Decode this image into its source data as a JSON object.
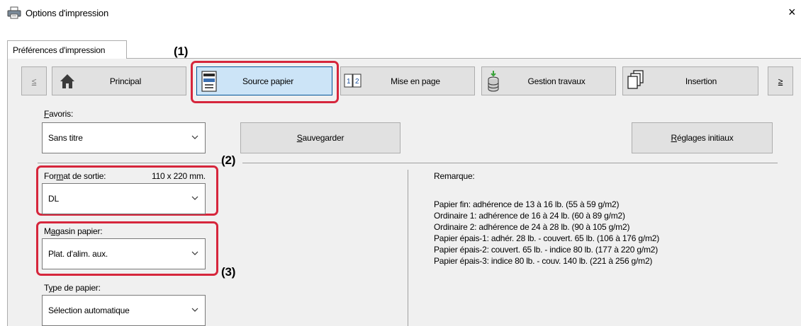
{
  "window": {
    "title": "Options d'impression",
    "close_glyph": "×"
  },
  "tab": {
    "label": "Préférences d'impression"
  },
  "nav": {
    "prev_glyph": "≤",
    "next_glyph": "≥",
    "buttons": [
      {
        "label": "Principal",
        "icon": "home-icon"
      },
      {
        "label": "Source papier",
        "icon": "paper-tray-icon",
        "selected": true
      },
      {
        "label": "Mise en page",
        "icon": "layout-icon"
      },
      {
        "label": "Gestion travaux",
        "icon": "job-storage-icon"
      },
      {
        "label": "Insertion",
        "icon": "pages-insert-icon"
      }
    ]
  },
  "favorites": {
    "label_first": "F",
    "label_rest": "avoris:",
    "value": "Sans titre",
    "save_first": "S",
    "save_rest": "auvegarder",
    "reset_first": "R",
    "reset_rest": "églages initiaux"
  },
  "output_size": {
    "label_pre": "For",
    "label_u": "m",
    "label_post": "at de sortie:",
    "dimensions": "110 x 220 mm.",
    "value": "DL"
  },
  "paper_tray": {
    "label_pre": "M",
    "label_u": "a",
    "label_post": "gasin papier:",
    "value": "Plat. d'alim. aux."
  },
  "paper_type": {
    "label_pre": "T",
    "label_u": "y",
    "label_post": "pe de papier:",
    "value": "Sélection automatique"
  },
  "remark": {
    "title": "Remarque:",
    "lines": [
      "Papier fin: adhérence de 13 à 16 lb. (55 à 59 g/m2)",
      "Ordinaire 1: adhérence de 16 à 24 lb. (60 à 89 g/m2)",
      "Ordinaire 2: adhérence de 24 à 28 lb. (90 à 105 g/m2)",
      "Papier épais-1: adhér. 28 lb. - couvert. 65 lb. (106 à 176 g/m2)",
      "Papier épais-2: couvert. 65 lb. - indice 80 lb. (177 à 220 g/m2)",
      "Papier épais-3: indice 80 lb. - couv. 140 lb. (221 à 256 g/m2)"
    ]
  },
  "callouts": {
    "c1": "(1)",
    "c2": "(2)",
    "c3": "(3)"
  },
  "colors": {
    "callout": "#d6263c",
    "selected_bg": "#cce4f7",
    "panel_bg": "#f0f0f0"
  }
}
